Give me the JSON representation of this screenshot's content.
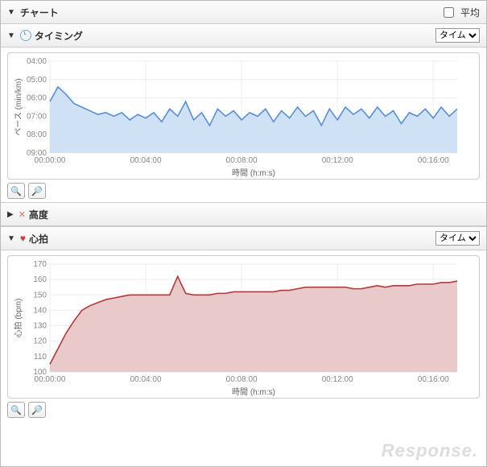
{
  "header": {
    "title": "チャート",
    "average_label": "平均",
    "average_checked": false
  },
  "sections": {
    "timing": {
      "title": "タイミング",
      "dropdown": "タイム",
      "expanded": true
    },
    "elevation": {
      "title": "高度",
      "expanded": false
    },
    "hr": {
      "title": "心拍",
      "dropdown": "タイム",
      "expanded": true
    }
  },
  "axis": {
    "x_label": "時間 (h:m:s)",
    "pace_y_label": "ペース (min/km)",
    "hr_y_label": "心拍 (bpm)"
  },
  "watermark": "Response.",
  "chart_data": [
    {
      "type": "line",
      "name": "pace",
      "title": "タイミング",
      "xlabel": "時間 (h:m:s)",
      "ylabel": "ペース (min/km)",
      "x_ticks_seconds": [
        0,
        240,
        480,
        720,
        960
      ],
      "x_tick_labels": [
        "00:00:00",
        "00:04:00",
        "00:08:00",
        "00:12:00",
        "00:16:00"
      ],
      "y_ticks_min_per_km": [
        4.0,
        5.0,
        6.0,
        7.0,
        8.0,
        9.0
      ],
      "y_tick_labels": [
        "04:00",
        "05:00",
        "06:00",
        "07:00",
        "08:00",
        "09:00"
      ],
      "ylim": [
        9.0,
        4.0
      ],
      "xlim": [
        0,
        1020
      ],
      "series": [
        {
          "name": "pace_min_per_km",
          "color": "#5a8fd6",
          "fill": "#cfe1f5",
          "x_seconds": [
            0,
            20,
            40,
            60,
            80,
            100,
            120,
            140,
            160,
            180,
            200,
            220,
            240,
            260,
            280,
            300,
            320,
            340,
            360,
            380,
            400,
            420,
            440,
            460,
            480,
            500,
            520,
            540,
            560,
            580,
            600,
            620,
            640,
            660,
            680,
            700,
            720,
            740,
            760,
            780,
            800,
            820,
            840,
            860,
            880,
            900,
            920,
            940,
            960,
            980,
            1000,
            1020
          ],
          "values": [
            6.2,
            5.4,
            5.8,
            6.3,
            6.5,
            6.7,
            6.9,
            6.8,
            7.0,
            6.8,
            7.2,
            6.9,
            7.1,
            6.8,
            7.3,
            6.6,
            7.0,
            6.2,
            7.2,
            6.8,
            7.5,
            6.6,
            7.0,
            6.7,
            7.2,
            6.8,
            7.0,
            6.6,
            7.3,
            6.7,
            7.1,
            6.5,
            7.0,
            6.7,
            7.5,
            6.6,
            7.2,
            6.5,
            6.9,
            6.6,
            7.1,
            6.5,
            7.0,
            6.7,
            7.4,
            6.8,
            7.0,
            6.6,
            7.1,
            6.5,
            7.0,
            6.6
          ]
        }
      ]
    },
    {
      "type": "line",
      "name": "heart_rate",
      "title": "心拍",
      "xlabel": "時間 (h:m:s)",
      "ylabel": "心拍 (bpm)",
      "x_ticks_seconds": [
        0,
        240,
        480,
        720,
        960
      ],
      "x_tick_labels": [
        "00:00:00",
        "00:04:00",
        "00:08:00",
        "00:12:00",
        "00:16:00"
      ],
      "y_ticks_bpm": [
        100,
        110,
        120,
        130,
        140,
        150,
        160,
        170
      ],
      "y_tick_labels": [
        "100",
        "110",
        "120",
        "130",
        "140",
        "150",
        "160",
        "170"
      ],
      "ylim": [
        100,
        170
      ],
      "xlim": [
        0,
        1020
      ],
      "series": [
        {
          "name": "bpm",
          "color": "#b23a3a",
          "fill": "#e9c9c9",
          "x_seconds": [
            0,
            20,
            40,
            60,
            80,
            100,
            120,
            140,
            160,
            180,
            200,
            220,
            240,
            260,
            280,
            300,
            320,
            340,
            360,
            380,
            400,
            420,
            440,
            460,
            480,
            500,
            520,
            540,
            560,
            580,
            600,
            620,
            640,
            660,
            680,
            700,
            720,
            740,
            760,
            780,
            800,
            820,
            840,
            860,
            880,
            900,
            920,
            940,
            960,
            980,
            1000,
            1020
          ],
          "values": [
            105,
            115,
            125,
            133,
            140,
            143,
            145,
            147,
            148,
            149,
            150,
            150,
            150,
            150,
            150,
            150,
            162,
            151,
            150,
            150,
            150,
            151,
            151,
            152,
            152,
            152,
            152,
            152,
            152,
            153,
            153,
            154,
            155,
            155,
            155,
            155,
            155,
            155,
            154,
            154,
            155,
            156,
            155,
            156,
            156,
            156,
            157,
            157,
            157,
            158,
            158,
            159
          ]
        }
      ]
    }
  ]
}
